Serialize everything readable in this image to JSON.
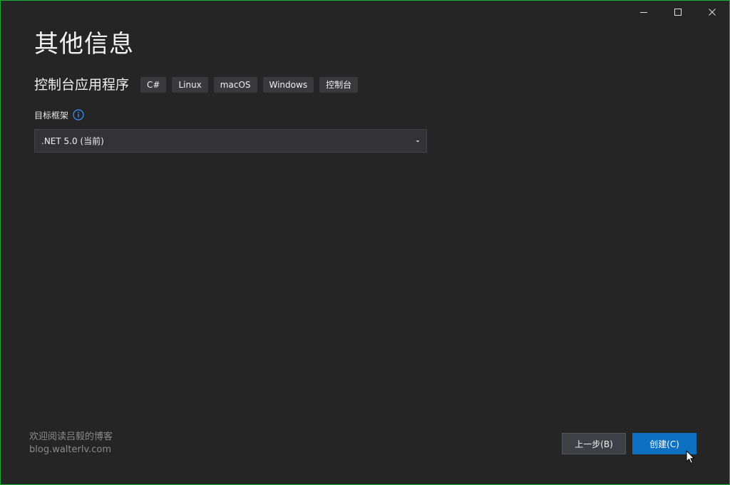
{
  "window": {
    "controls": {
      "minimize_icon": "minimize-icon",
      "maximize_icon": "maximize-icon",
      "close_icon": "close-icon"
    }
  },
  "page": {
    "title": "其他信息"
  },
  "template": {
    "name": "控制台应用程序",
    "tags": [
      "C#",
      "Linux",
      "macOS",
      "Windows",
      "控制台"
    ]
  },
  "framework": {
    "label": "目标框架",
    "info_icon": "info-icon",
    "selected": ".NET 5.0 (当前)"
  },
  "watermark": {
    "line1": "欢迎阅读吕毅的博客",
    "line2": "blog.walterlv.com"
  },
  "footer": {
    "back_label": "上一步(B)",
    "create_label": "创建(C)"
  },
  "colors": {
    "background": "#252526",
    "accent": "#0e70c0",
    "window_border": "#1ea83a"
  }
}
